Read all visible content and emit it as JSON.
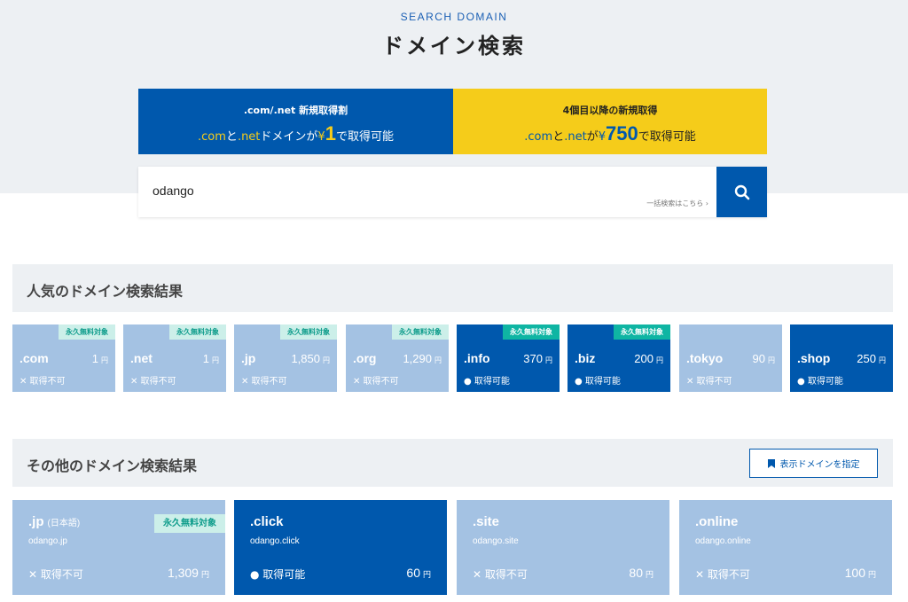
{
  "header": {
    "eyebrow": "SEARCH DOMAIN",
    "title": "ドメイン検索"
  },
  "promos": [
    {
      "title": ".com/.net 新規取得割",
      "p1": ".com",
      "p2": "と",
      "p3": ".net",
      "p4": "ドメインが",
      "p5": "¥",
      "p6": "1",
      "p7": "で取得可能"
    },
    {
      "title": "4個目以降の新規取得",
      "p1": ".com",
      "p2": "と",
      "p3": ".net",
      "p4": "が",
      "p5": "¥",
      "p6": "750",
      "p7": "で取得可能"
    }
  ],
  "search": {
    "value": "odango",
    "bulk_link": "一括検索はこちら ›",
    "button_icon": "search-icon"
  },
  "popular": {
    "title": "人気のドメイン検索結果",
    "cards": [
      {
        "tld": ".com",
        "price": "1",
        "yen": "円",
        "status": "✕ 取得不可",
        "badge": "永久無料対象",
        "available": false
      },
      {
        "tld": ".net",
        "price": "1",
        "yen": "円",
        "status": "✕ 取得不可",
        "badge": "永久無料対象",
        "available": false
      },
      {
        "tld": ".jp",
        "price": "1,850",
        "yen": "円",
        "status": "✕ 取得不可",
        "badge": "永久無料対象",
        "available": false
      },
      {
        "tld": ".org",
        "price": "1,290",
        "yen": "円",
        "status": "✕ 取得不可",
        "badge": "永久無料対象",
        "available": false
      },
      {
        "tld": ".info",
        "price": "370",
        "yen": "円",
        "status": "● 取得可能",
        "badge": "永久無料対象",
        "available": true
      },
      {
        "tld": ".biz",
        "price": "200",
        "yen": "円",
        "status": "● 取得可能",
        "badge": "永久無料対象",
        "available": true
      },
      {
        "tld": ".tokyo",
        "price": "90",
        "yen": "円",
        "status": "✕ 取得不可",
        "badge": "",
        "available": false
      },
      {
        "tld": ".shop",
        "price": "250",
        "yen": "円",
        "status": "● 取得可能",
        "badge": "",
        "available": true
      }
    ]
  },
  "others": {
    "title": "その他のドメイン検索結果",
    "specify_button": "表示ドメインを指定",
    "cards": [
      {
        "tld": ".jp",
        "sub": "(日本語)",
        "domain": "odango.jp",
        "status": "✕ 取得不可",
        "price": "1,309",
        "yen": "円",
        "badge": "永久無料対象",
        "available": false
      },
      {
        "tld": ".click",
        "sub": "",
        "domain": "odango.click",
        "status": "● 取得可能",
        "price": "60",
        "yen": "円",
        "badge": "",
        "available": true
      },
      {
        "tld": ".site",
        "sub": "",
        "domain": "odango.site",
        "status": "✕ 取得不可",
        "price": "80",
        "yen": "円",
        "badge": "",
        "available": false
      },
      {
        "tld": ".online",
        "sub": "",
        "domain": "odango.online",
        "status": "✕ 取得不可",
        "price": "100",
        "yen": "円",
        "badge": "",
        "available": false
      }
    ]
  },
  "colors": {
    "primary": "#0058ad",
    "accent_yellow": "#f5cc1a",
    "unavailable": "#a4c2e3",
    "badge_teal": "#0fb5a3"
  }
}
